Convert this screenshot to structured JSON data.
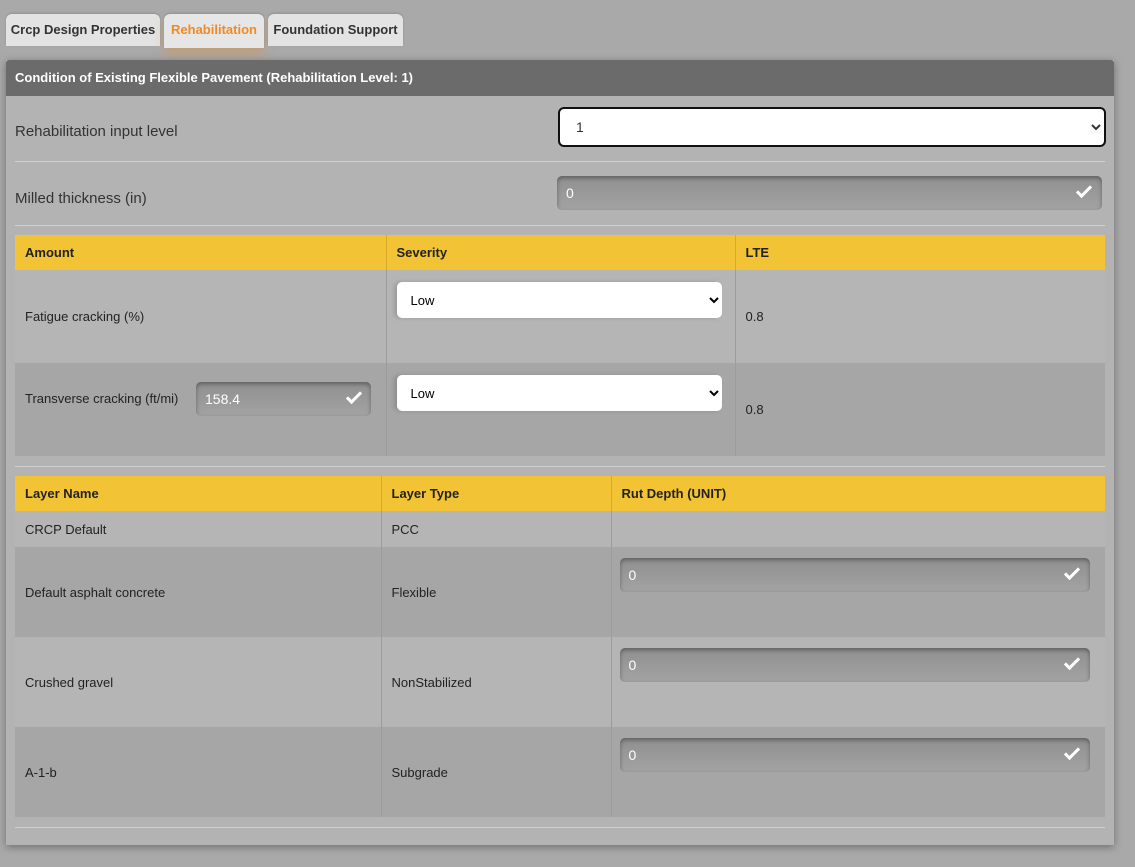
{
  "tabs": [
    {
      "label": "Crcp Design Properties"
    },
    {
      "label": "Rehabilitation"
    },
    {
      "label": "Foundation Support"
    }
  ],
  "panel": {
    "title": "Condition of Existing Flexible Pavement (Rehabilitation Level: 1)",
    "rehab_input_level": {
      "label": "Rehabilitation input level",
      "value": "1"
    },
    "milled_thickness": {
      "label": "Milled thickness (in)",
      "value": "0"
    }
  },
  "distress_table": {
    "headers": [
      "Amount",
      "Severity",
      "LTE"
    ],
    "rows": [
      {
        "amount": "Fatigue cracking (%)",
        "severity": "Low",
        "lte": "0.8"
      },
      {
        "amount": "Transverse cracking (ft/mi)",
        "amount_value": "158.4",
        "severity": "Low",
        "lte": "0.8"
      }
    ]
  },
  "layer_table": {
    "headers": [
      "Layer Name",
      "Layer Type",
      "Rut Depth (UNIT)"
    ],
    "rows": [
      {
        "name": "CRCP Default",
        "type": "PCC",
        "rut": ""
      },
      {
        "name": "Default asphalt concrete",
        "type": "Flexible",
        "rut": "0"
      },
      {
        "name": "Crushed gravel",
        "type": "NonStabilized",
        "rut": "0"
      },
      {
        "name": "A-1-b",
        "type": "Subgrade",
        "rut": "0"
      }
    ]
  }
}
